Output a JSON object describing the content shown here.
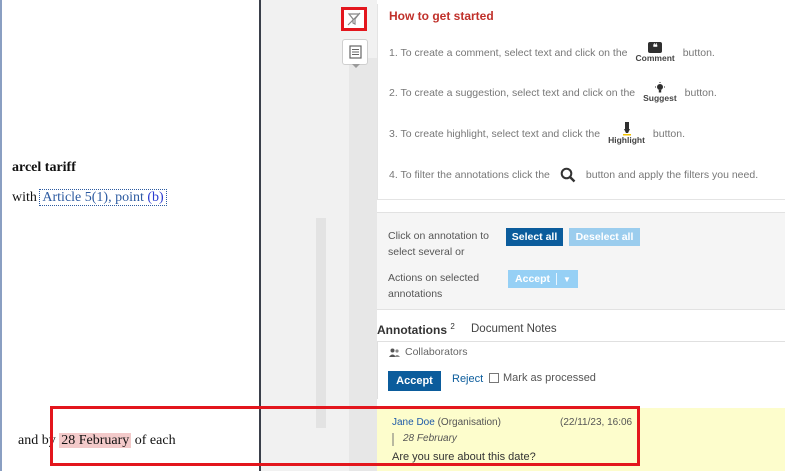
{
  "document": {
    "heading": "arcel tariff",
    "line1": {
      "prefix": "with ",
      "ref": "Article 5(1), point",
      "ref_b": "(b)"
    },
    "line2": {
      "prefix": "and by ",
      "highlight": "28 February",
      "suffix": " of each"
    }
  },
  "guide": {
    "title": "How to get started",
    "step1": {
      "text": "1. To create a comment, select text and click on the",
      "icon_label": "Comment",
      "suffix": "button."
    },
    "step2": {
      "text": "2. To create a suggestion, select text and click on the",
      "icon_label": "Suggest",
      "suffix": "button."
    },
    "step3": {
      "text": "3. To create highlight, select text and click the",
      "icon_label": "Highlight",
      "suffix": "button."
    },
    "step4": {
      "text": "4. To filter the annotations click the",
      "suffix": "button and apply the filters you need."
    }
  },
  "actions": {
    "click_label": "Click on annotation to select several or",
    "select_all": "Select all",
    "deselect_all": "Deselect all",
    "actions_label": "Actions on selected annotations",
    "accept": "Accept",
    "accept_arrow": "▼"
  },
  "tabs": {
    "annotations": "Annotations",
    "annotations_count": "2",
    "notes": "Document Notes"
  },
  "card": {
    "collaborators": "Collaborators",
    "accept": "Accept",
    "reject": "Reject",
    "mark_processed": "Mark as processed"
  },
  "comment": {
    "author": "Jane Doe",
    "org": "(Organisation)",
    "date": "(22/11/23, 16:06",
    "quote": "28 February",
    "text": "Are you sure about this date?"
  },
  "colors": {
    "accent_red": "#c0302a",
    "primary_blue": "#0b5c9c",
    "comment_bg": "#fdfdcc",
    "highlight_frame": "#e3161d"
  },
  "icons": [
    "filter-off-icon",
    "notes-icon",
    "comment-icon",
    "suggest-icon",
    "highlight-icon",
    "search-icon",
    "collaborators-icon"
  ]
}
